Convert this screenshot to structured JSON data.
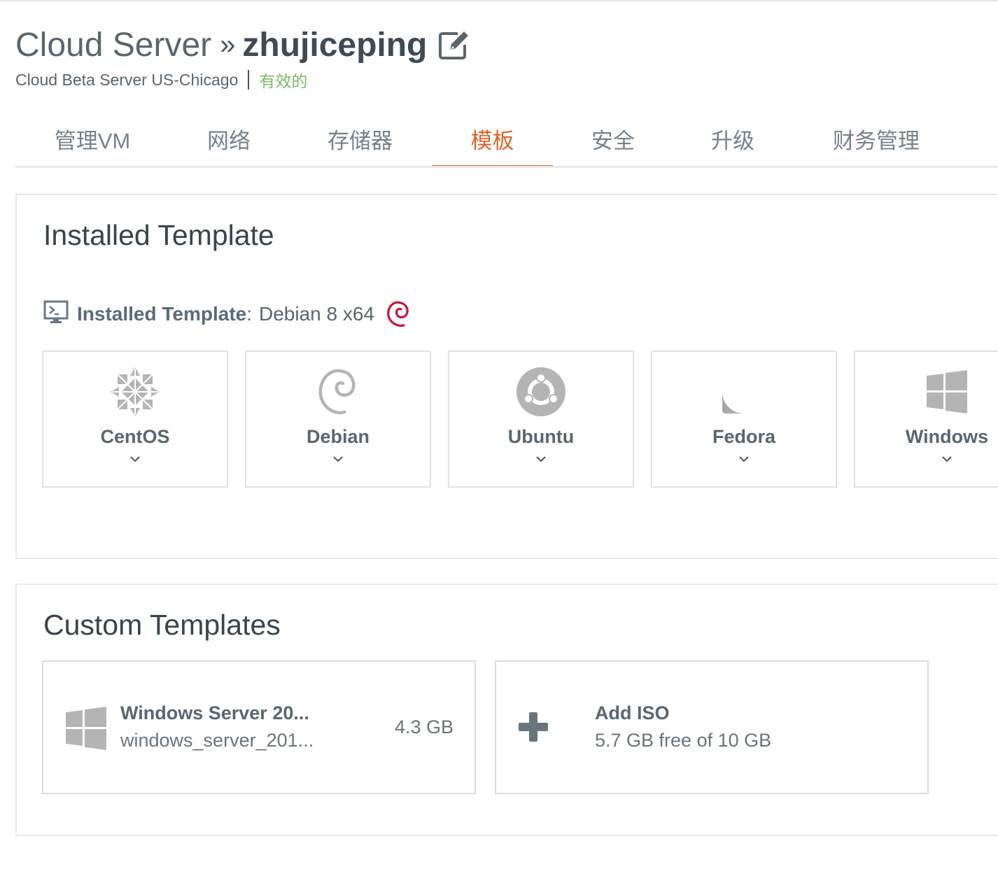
{
  "header": {
    "title_prefix": "Cloud Server",
    "separator": "»",
    "server_name": "zhujiceping",
    "location": "Cloud Beta Server US-Chicago",
    "status": "有效的",
    "edit_icon": "edit-icon"
  },
  "tabs": [
    {
      "label": "管理VM",
      "active": false
    },
    {
      "label": "网络",
      "active": false
    },
    {
      "label": "存储器",
      "active": false
    },
    {
      "label": "模板",
      "active": true
    },
    {
      "label": "安全",
      "active": false
    },
    {
      "label": "升级",
      "active": false
    },
    {
      "label": "财务管理",
      "active": false
    }
  ],
  "installed": {
    "heading": "Installed Template",
    "label": "Installed Template",
    "colon": ":",
    "value": "Debian 8 x64",
    "os_options": [
      {
        "name": "CentOS",
        "icon": "centos-icon"
      },
      {
        "name": "Debian",
        "icon": "debian-icon"
      },
      {
        "name": "Ubuntu",
        "icon": "ubuntu-icon"
      },
      {
        "name": "Fedora",
        "icon": "fedora-icon"
      },
      {
        "name": "Windows",
        "icon": "windows-icon"
      }
    ]
  },
  "custom": {
    "heading": "Custom Templates",
    "items": [
      {
        "title": "Windows Server 20...",
        "subtitle": "windows_server_201...",
        "size": "4.3 GB",
        "icon": "windows-icon"
      }
    ],
    "add": {
      "title": "Add ISO",
      "subtitle": "5.7 GB free of 10 GB",
      "icon": "plus-icon"
    }
  },
  "colors": {
    "accent": "#d8642a",
    "status_green": "#7dbb6e",
    "debian_red": "#c8143c",
    "icon_gray": "#b3b3b3"
  }
}
